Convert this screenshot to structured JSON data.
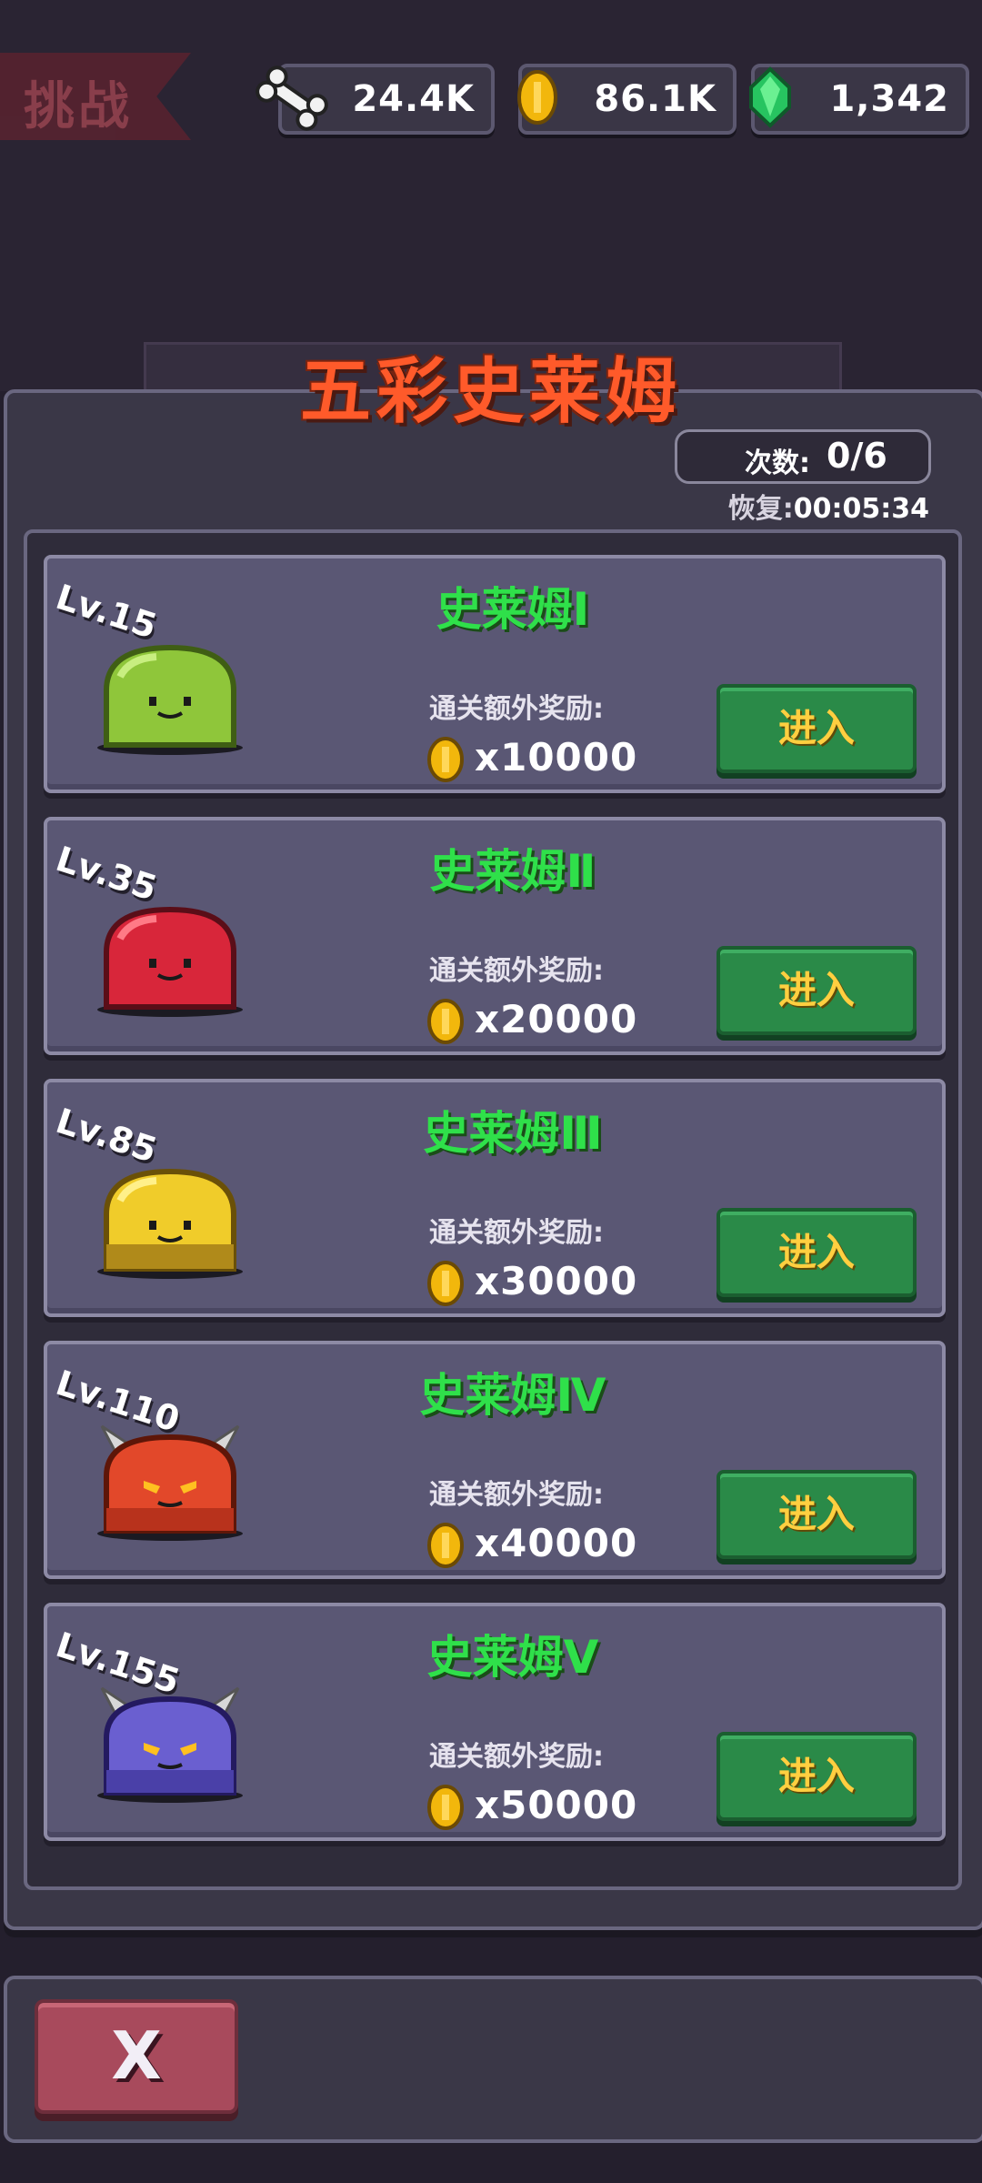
{
  "topbar": {
    "challenge_label": "挑战",
    "bones": "24.4K",
    "coins": "86.1K",
    "gems": "1,342"
  },
  "panel": {
    "title": "五彩史莱姆",
    "count_label": "次数:",
    "count_value": "0/6",
    "recover_label": "恢复:",
    "recover_value": "00:05:34",
    "bonus_label": "通关额外奖励:",
    "enter_label": "进入"
  },
  "stages": [
    {
      "level": "Lv.15",
      "name": "史莱姆Ⅰ",
      "reward": "x10000",
      "color": "#8fc63a"
    },
    {
      "level": "Lv.35",
      "name": "史莱姆Ⅱ",
      "reward": "x20000",
      "color": "#d8263a"
    },
    {
      "level": "Lv.85",
      "name": "史莱姆Ⅲ",
      "reward": "x30000",
      "color": "#f0cc2a"
    },
    {
      "level": "Lv.110",
      "name": "史莱姆Ⅳ",
      "reward": "x40000",
      "color": "#e2482a"
    },
    {
      "level": "Lv.155",
      "name": "史莱姆Ⅴ",
      "reward": "x50000",
      "color": "#6a5fd0"
    }
  ],
  "footer": {
    "close_label": "X"
  },
  "icons": {
    "bone": "bone-icon",
    "coin": "coin-icon",
    "gem": "gem-icon"
  }
}
